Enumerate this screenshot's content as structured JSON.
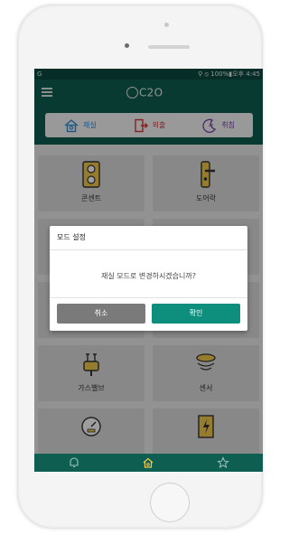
{
  "status": {
    "left": "G",
    "right": "⚲ ⦸ 100%▮오후 4:45"
  },
  "app": {
    "logo_text": "C2O"
  },
  "modes": [
    {
      "label": "재실",
      "color": "#2f8bd6"
    },
    {
      "label": "외출",
      "color": "#d93535"
    },
    {
      "label": "취침",
      "color": "#7a3fb0"
    }
  ],
  "tiles": [
    {
      "label": "콘센트",
      "icon": "outlet-icon"
    },
    {
      "label": "도어락",
      "icon": "door-lock-icon"
    },
    {
      "label": "",
      "icon": ""
    },
    {
      "label": "",
      "icon": ""
    },
    {
      "label": "",
      "icon": ""
    },
    {
      "label": "",
      "icon": ""
    },
    {
      "label": "가스밸브",
      "icon": "gas-valve-icon"
    },
    {
      "label": "센서",
      "icon": "sensor-icon"
    },
    {
      "label": "",
      "icon": "gauge-icon"
    },
    {
      "label": "",
      "icon": "power-panel-icon"
    }
  ],
  "dialog": {
    "title": "모드 설정",
    "message": "재실 모드로 변경하시겠습니까?",
    "cancel": "취소",
    "ok": "확인"
  },
  "bottom_nav": [
    "bell-icon",
    "home-icon",
    "star-icon"
  ],
  "colors": {
    "header": "#0f5e52",
    "statusbar": "#0b4a40",
    "ok": "#0e8f7e",
    "cancel": "#7a7a7a"
  }
}
